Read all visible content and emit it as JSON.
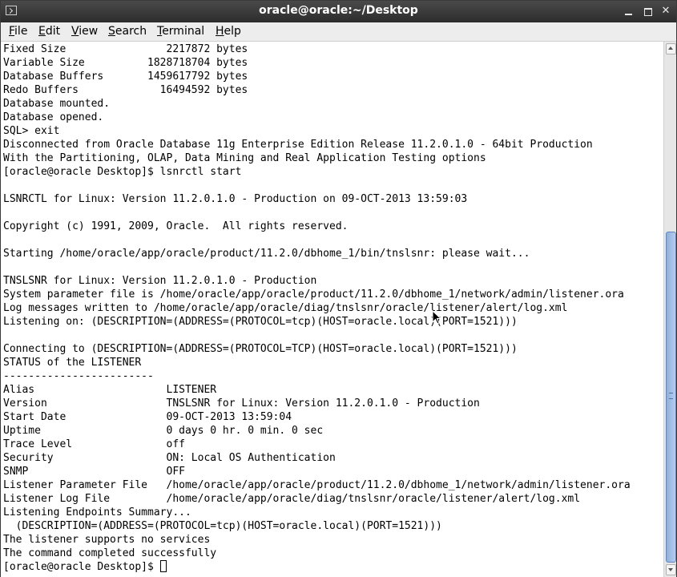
{
  "window": {
    "title": "oracle@oracle:~/Desktop"
  },
  "menubar": {
    "items": [
      {
        "mnemonic": "F",
        "rest": "ile"
      },
      {
        "mnemonic": "E",
        "rest": "dit"
      },
      {
        "mnemonic": "V",
        "rest": "iew"
      },
      {
        "mnemonic": "S",
        "rest": "earch"
      },
      {
        "mnemonic": "T",
        "rest": "erminal"
      },
      {
        "mnemonic": "H",
        "rest": "elp"
      }
    ]
  },
  "terminal": {
    "lines": [
      "Fixed Size                2217872 bytes",
      "Variable Size          1828718704 bytes",
      "Database Buffers       1459617792 bytes",
      "Redo Buffers             16494592 bytes",
      "Database mounted.",
      "Database opened.",
      "SQL> exit",
      "Disconnected from Oracle Database 11g Enterprise Edition Release 11.2.0.1.0 - 64bit Production",
      "With the Partitioning, OLAP, Data Mining and Real Application Testing options",
      "[oracle@oracle Desktop]$ lsnrctl start",
      "",
      "LSNRCTL for Linux: Version 11.2.0.1.0 - Production on 09-OCT-2013 13:59:03",
      "",
      "Copyright (c) 1991, 2009, Oracle.  All rights reserved.",
      "",
      "Starting /home/oracle/app/oracle/product/11.2.0/dbhome_1/bin/tnslsnr: please wait...",
      "",
      "TNSLSNR for Linux: Version 11.2.0.1.0 - Production",
      "System parameter file is /home/oracle/app/oracle/product/11.2.0/dbhome_1/network/admin/listener.ora",
      "Log messages written to /home/oracle/app/oracle/diag/tnslsnr/oracle/listener/alert/log.xml",
      "Listening on: (DESCRIPTION=(ADDRESS=(PROTOCOL=tcp)(HOST=oracle.local)(PORT=1521)))",
      "",
      "Connecting to (DESCRIPTION=(ADDRESS=(PROTOCOL=TCP)(HOST=oracle.local)(PORT=1521)))",
      "STATUS of the LISTENER",
      "------------------------",
      "Alias                     LISTENER",
      "Version                   TNSLSNR for Linux: Version 11.2.0.1.0 - Production",
      "Start Date                09-OCT-2013 13:59:04",
      "Uptime                    0 days 0 hr. 0 min. 0 sec",
      "Trace Level               off",
      "Security                  ON: Local OS Authentication",
      "SNMP                      OFF",
      "Listener Parameter File   /home/oracle/app/oracle/product/11.2.0/dbhome_1/network/admin/listener.ora",
      "Listener Log File         /home/oracle/app/oracle/diag/tnslsnr/oracle/listener/alert/log.xml",
      "Listening Endpoints Summary...",
      "  (DESCRIPTION=(ADDRESS=(PROTOCOL=tcp)(HOST=oracle.local)(PORT=1521)))",
      "The listener supports no services",
      "The command completed successfully"
    ],
    "prompt": "[oracle@oracle Desktop]$ "
  }
}
